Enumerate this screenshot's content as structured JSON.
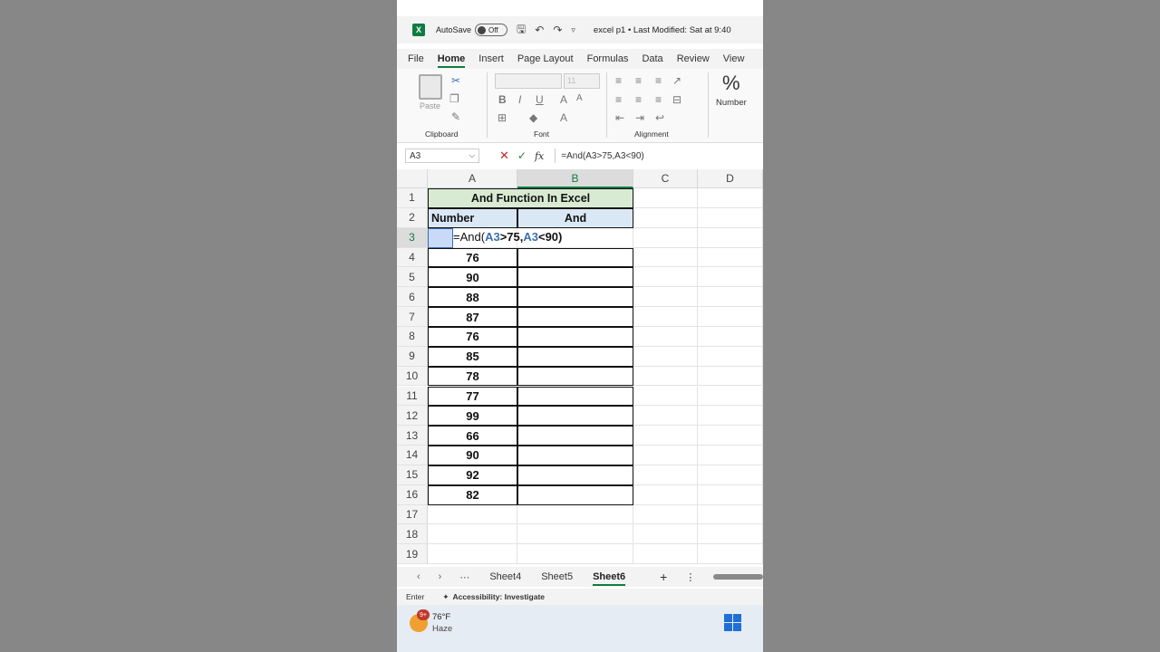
{
  "titlebar": {
    "logo": "X",
    "autosave_label": "AutoSave",
    "toggle_label": "Off",
    "doc_title": "excel p1 • Last Modified: Sat at 9:40"
  },
  "tabs": [
    "File",
    "Home",
    "Insert",
    "Page Layout",
    "Formulas",
    "Data",
    "Review",
    "View"
  ],
  "ribbon": {
    "paste_label": "Paste",
    "clipboard_label": "Clipboard",
    "font_label": "Font",
    "font_size": "11",
    "alignment_label": "Alignment",
    "number_label": "Number"
  },
  "formula_bar": {
    "name_box": "A3",
    "formula": "=And(A3>75,A3<90)"
  },
  "grid": {
    "columns": [
      "A",
      "B",
      "C",
      "D"
    ],
    "rows": [
      "1",
      "2",
      "3",
      "4",
      "5",
      "6",
      "7",
      "8",
      "9",
      "10",
      "11",
      "12",
      "13",
      "14",
      "15",
      "16",
      "17",
      "18",
      "19"
    ],
    "title": "And Function In Excel",
    "header_number": "Number",
    "header_and": "And",
    "edit": {
      "prefix": "=And(",
      "ref1": "A3",
      "mid": ">75,",
      "ref2": "A3",
      "suffix": "<90)"
    },
    "values": [
      "76",
      "90",
      "88",
      "87",
      "76",
      "85",
      "78",
      "77",
      "99",
      "66",
      "90",
      "92",
      "82"
    ]
  },
  "sheets": [
    "Sheet4",
    "Sheet5",
    "Sheet6"
  ],
  "status": {
    "mode": "Enter",
    "accessibility": "Accessibility: Investigate"
  },
  "taskbar": {
    "badge": "9+",
    "temperature": "76°F",
    "condition": "Haze"
  }
}
